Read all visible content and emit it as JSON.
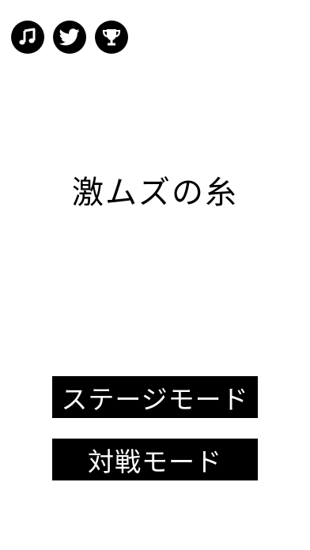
{
  "header": {
    "icons": [
      {
        "name": "music-icon"
      },
      {
        "name": "twitter-icon"
      },
      {
        "name": "trophy-icon"
      }
    ]
  },
  "title": "激ムズの糸",
  "menu": {
    "stage_mode_label": "ステージモード",
    "versus_mode_label": "対戦モード"
  },
  "colors": {
    "background": "#ffffff",
    "foreground": "#000000",
    "button_text": "#ffffff"
  }
}
